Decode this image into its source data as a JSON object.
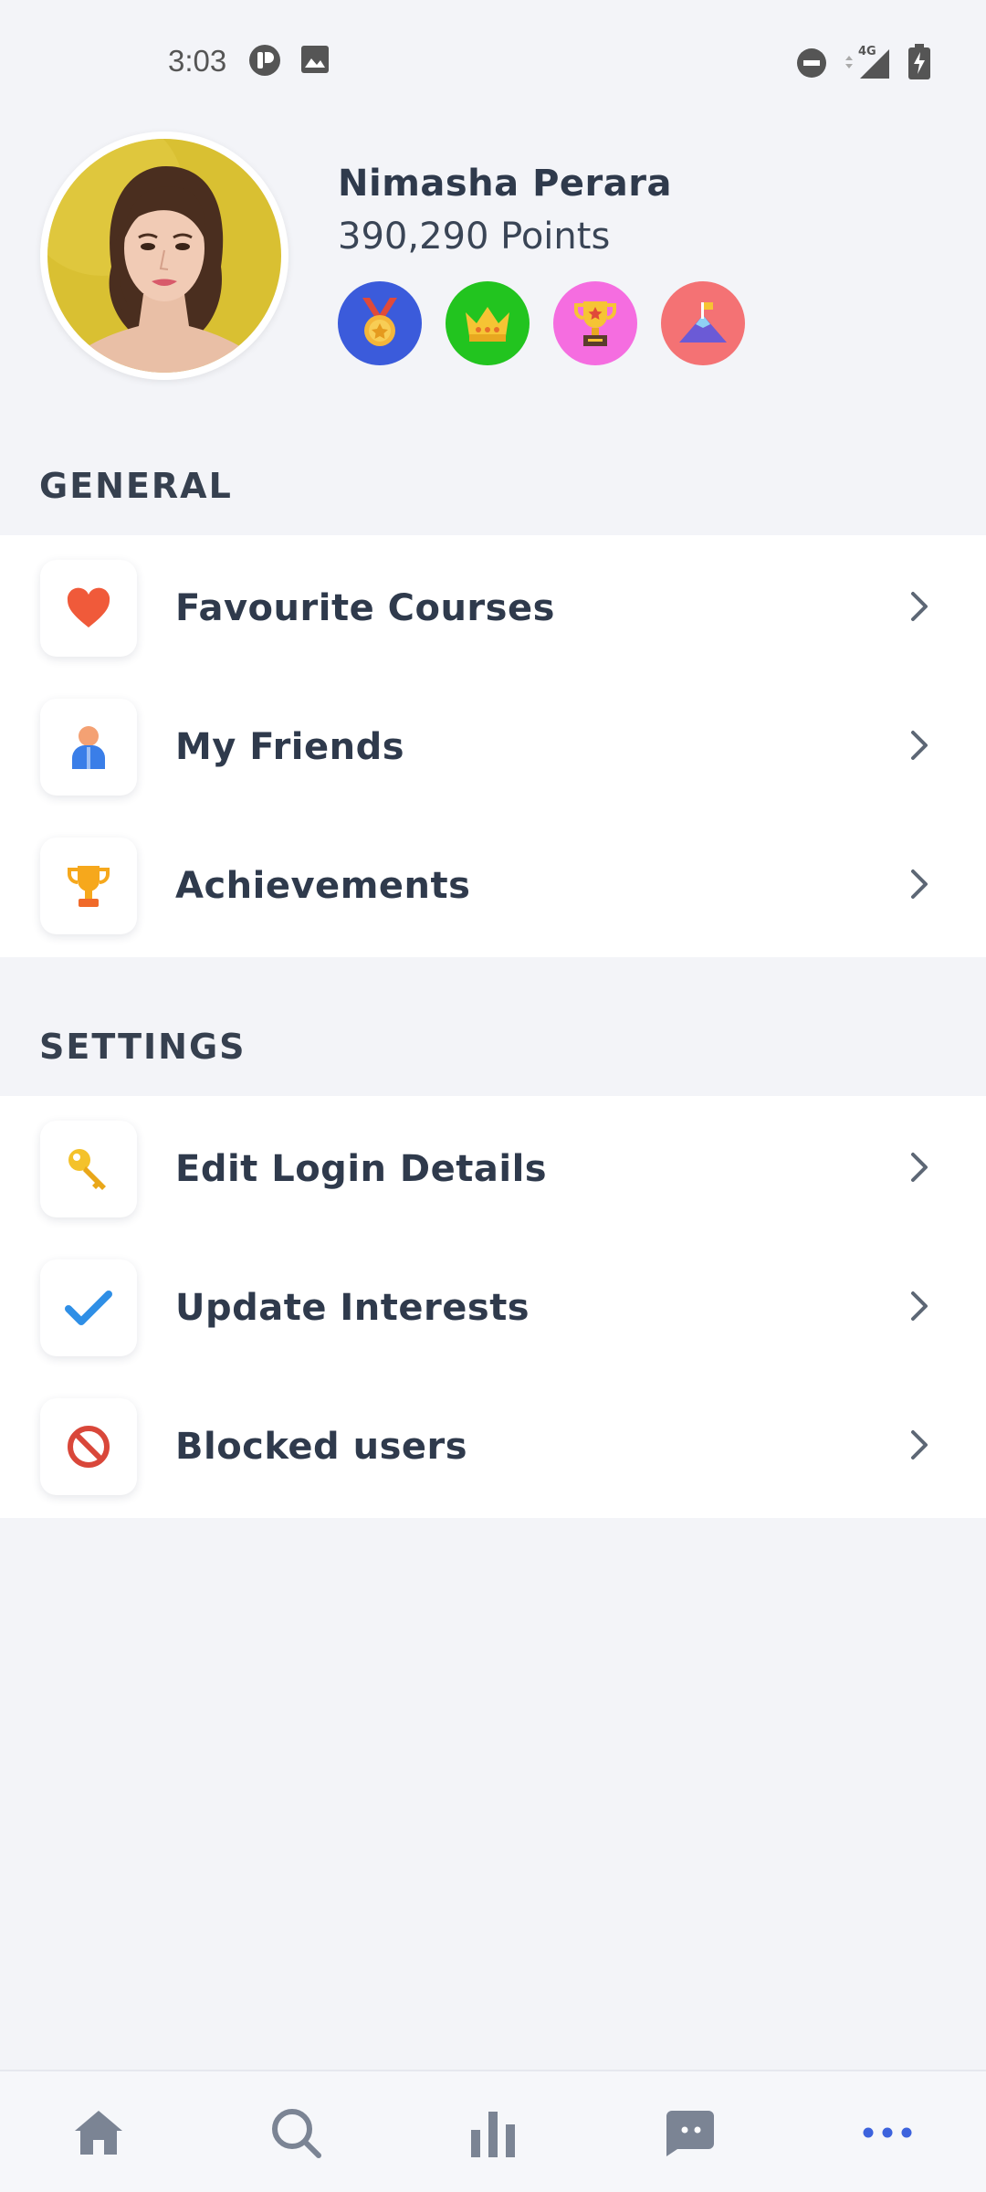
{
  "status_bar": {
    "time": "3:03",
    "icons": [
      "notification-app-icon",
      "image-icon",
      "do-not-disturb-icon",
      "signal-4g-icon",
      "battery-charging-icon"
    ],
    "network": "4G"
  },
  "profile": {
    "name": "Nimasha Perara",
    "points": "390,290 Points",
    "badges": [
      {
        "icon": "medal-icon",
        "color": "#3b5bdb"
      },
      {
        "icon": "crown-icon",
        "color": "#22c41f"
      },
      {
        "icon": "trophy-icon",
        "color": "#f56de0"
      },
      {
        "icon": "mountain-flag-icon",
        "color": "#f47274"
      }
    ]
  },
  "general": {
    "header": "GENERAL",
    "items": [
      {
        "label": "Favourite Courses",
        "icon": "heart-icon"
      },
      {
        "label": "My Friends",
        "icon": "person-icon"
      },
      {
        "label": "Achievements",
        "icon": "trophy-icon"
      }
    ]
  },
  "settings": {
    "header": "SETTINGS",
    "items": [
      {
        "label": "Edit Login Details",
        "icon": "key-icon"
      },
      {
        "label": "Update Interests",
        "icon": "checkmark-icon"
      },
      {
        "label": "Blocked users",
        "icon": "blocked-icon"
      }
    ]
  },
  "bottom_nav": {
    "items": [
      {
        "icon": "home-icon"
      },
      {
        "icon": "search-icon"
      },
      {
        "icon": "stats-icon"
      },
      {
        "icon": "chat-icon"
      },
      {
        "icon": "more-icon",
        "active": true
      }
    ],
    "active_color": "#3d63dd",
    "inactive_color": "#7b8494"
  }
}
